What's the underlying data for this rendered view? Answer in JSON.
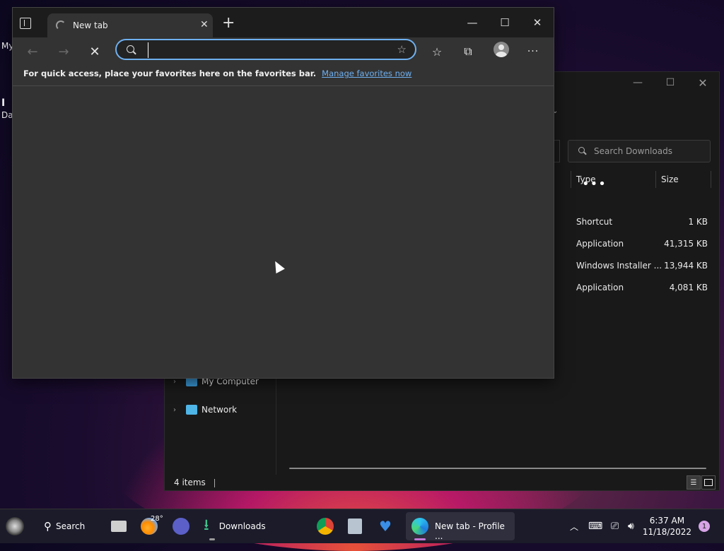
{
  "desktop": {
    "icon_labels": [
      "My",
      "I",
      "Da"
    ]
  },
  "edge": {
    "tab": {
      "title": "New tab"
    },
    "window_controls": {
      "minimize": "—",
      "maximize": "☐",
      "close": "✕"
    },
    "address_bar": {
      "value": "",
      "placeholder": ""
    },
    "favorites_bar": {
      "message": "For quick access, place your favorites here on the favorites bar.",
      "link": "Manage favorites now"
    }
  },
  "explorer": {
    "search_placeholder": "Search Downloads",
    "columns": {
      "type": "Type",
      "size": "Size"
    },
    "rows": [
      {
        "type": "Shortcut",
        "size": "1 KB"
      },
      {
        "type": "Application",
        "size": "41,315 KB"
      },
      {
        "type": "Windows Installer ...",
        "size": "13,944 KB"
      },
      {
        "type": "Application",
        "size": "4,081 KB"
      }
    ],
    "nav": [
      {
        "label": "My Computer",
        "icon": "computer-icon"
      },
      {
        "label": "Network",
        "icon": "network-icon"
      }
    ],
    "status": "4 items"
  },
  "taskbar": {
    "search_label": "Search",
    "weather_temp": "28°",
    "downloads_label": "Downloads",
    "edge_label": "New tab - Profile ...",
    "time": "6:37 AM",
    "date": "11/18/2022",
    "notification_count": "1"
  },
  "colors": {
    "accent": "#6fb0f0",
    "edge_active_indicator": "#c47ad8"
  }
}
